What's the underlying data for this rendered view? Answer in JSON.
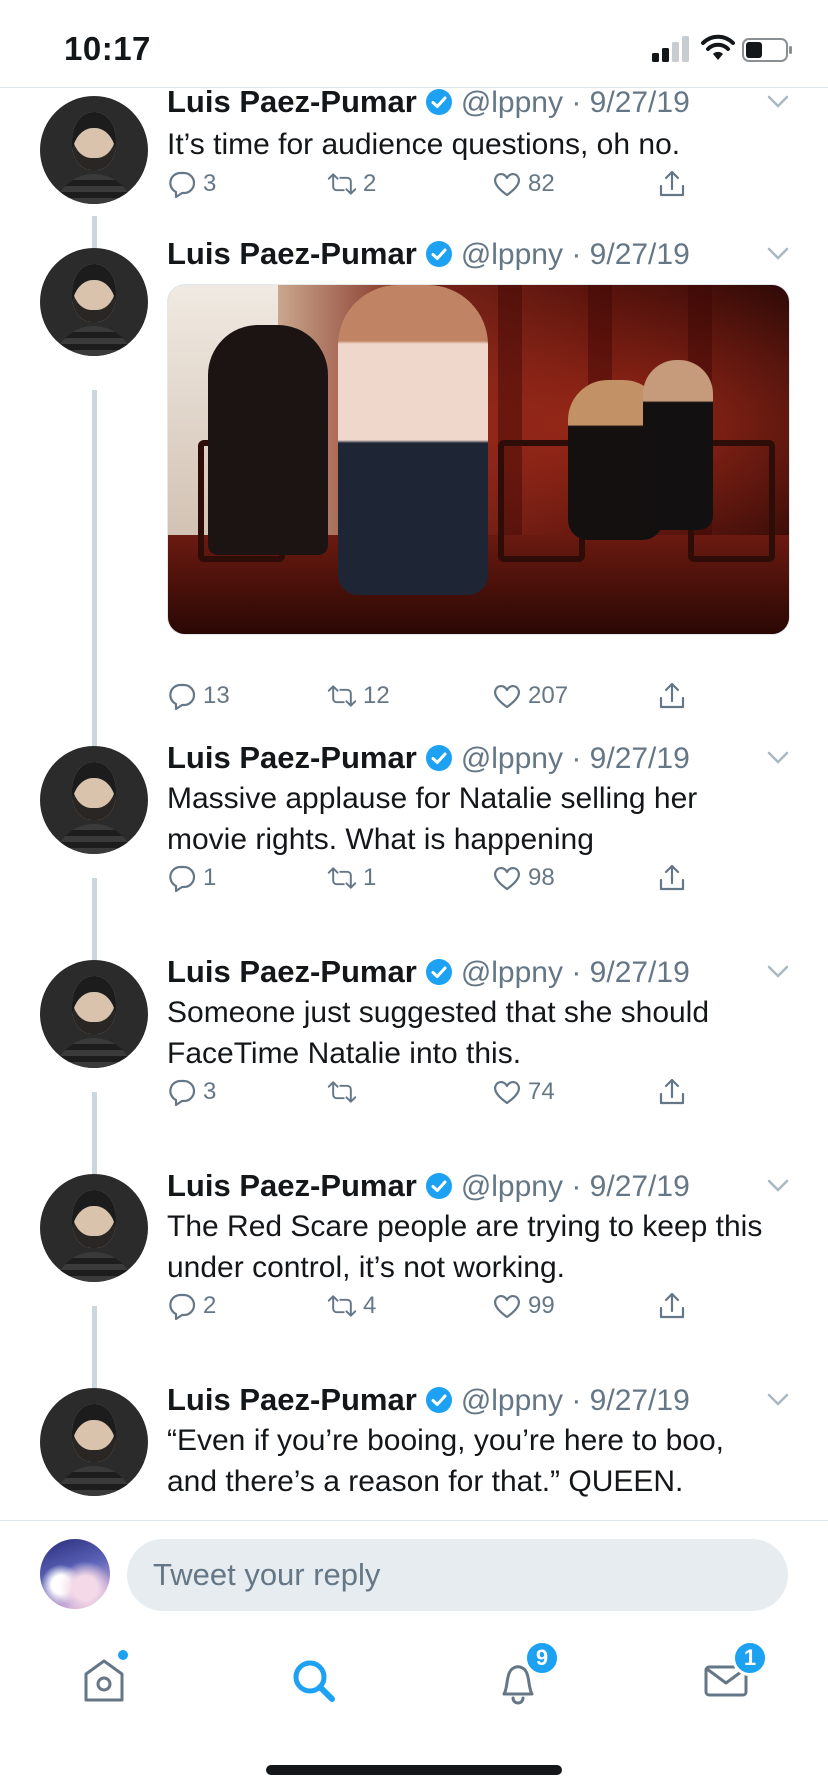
{
  "status_bar": {
    "time": "10:17"
  },
  "tweets": [
    {
      "name": "Luis Paez-Pumar",
      "handle": "@lppny",
      "date": "9/27/19",
      "text": "It’s time for audience questions, oh no.",
      "replies": "3",
      "retweets": "2",
      "likes": "82"
    },
    {
      "name": "Luis Paez-Pumar",
      "handle": "@lppny",
      "date": "9/27/19",
      "text": "",
      "replies": "13",
      "retweets": "12",
      "likes": "207"
    },
    {
      "name": "Luis Paez-Pumar",
      "handle": "@lppny",
      "date": "9/27/19",
      "text": "Massive applause for Natalie selling her movie rights. What is happening",
      "replies": "1",
      "retweets": "1",
      "likes": "98"
    },
    {
      "name": "Luis Paez-Pumar",
      "handle": "@lppny",
      "date": "9/27/19",
      "text": "Someone just suggested that she should FaceTime Natalie into this.",
      "replies": "3",
      "retweets": "",
      "likes": "74"
    },
    {
      "name": "Luis Paez-Pumar",
      "handle": "@lppny",
      "date": "9/27/19",
      "text": "The Red Scare people are trying to keep this under control, it’s not working.",
      "replies": "2",
      "retweets": "4",
      "likes": "99"
    },
    {
      "name": "Luis Paez-Pumar",
      "handle": "@lppny",
      "date": "9/27/19",
      "text": "“Even if you’re booing, you’re here to boo, and there’s a reason for that.” QUEEN.",
      "replies": "",
      "retweets": "",
      "likes": ""
    }
  ],
  "reply_bar": {
    "placeholder": "Tweet your reply"
  },
  "tab_bar": {
    "items": [
      {
        "icon": "home-icon",
        "badge": ""
      },
      {
        "icon": "search-icon",
        "badge": ""
      },
      {
        "icon": "bell-icon",
        "badge": "9"
      },
      {
        "icon": "mail-icon",
        "badge": "1"
      }
    ]
  },
  "colors": {
    "accent": "#1da1f2",
    "secondary_text": "#657786",
    "thread_line": "#ccd6dd"
  }
}
